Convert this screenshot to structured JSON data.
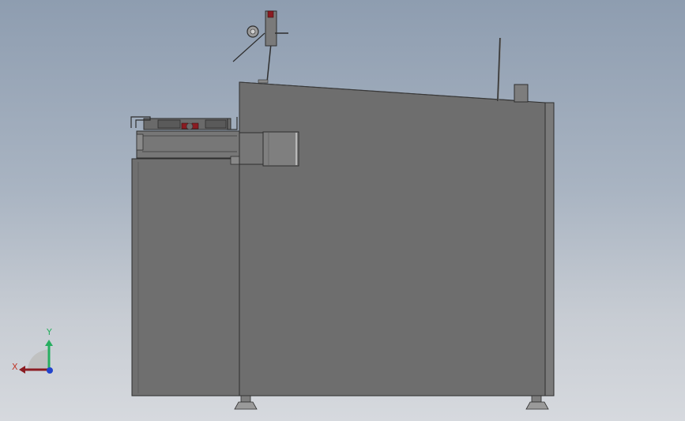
{
  "viewport": {
    "background_top": "#8e9db0",
    "background_bottom": "#d6d9de"
  },
  "model": {
    "body_color": "#6e6e6e",
    "edge_color": "#2e2e2e",
    "accent_color": "#8b1c22"
  },
  "triad": {
    "x_label": "X",
    "y_label": "Y",
    "x_color": "#c0392b",
    "y_color": "#27ae60",
    "z_color": "#2244cc"
  }
}
